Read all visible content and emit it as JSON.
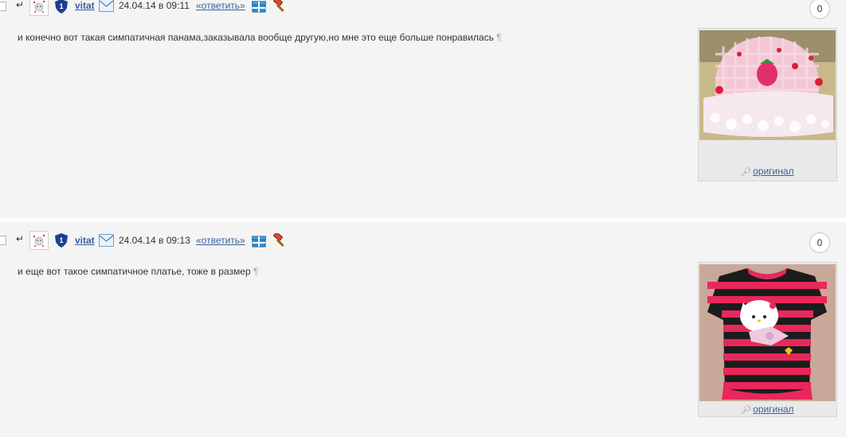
{
  "posts": [
    {
      "username": "vitat",
      "date": "24.04.14 в 09:11",
      "reply_label": "«ответить»",
      "counter": "0",
      "text": "и конечно вот такая симпатичная панама,заказывала вообще другую,но мне это еще больше понравилась",
      "pilcrow": "¶",
      "original_label": "оригинал"
    },
    {
      "username": "vitat",
      "date": "24.04.14 в 09:13",
      "reply_label": "«ответить»",
      "counter": "0",
      "text": "и еще вот такое симпатичное платье, тоже в размер",
      "pilcrow": "¶",
      "original_label": "оригинал"
    }
  ],
  "header_arrow": "↵",
  "rank_badge": "1",
  "icons": [
    "checkbox",
    "reply-arrow-icon",
    "avatar",
    "rank-shield-icon",
    "mail-icon",
    "gift-icon",
    "hammer-icon",
    "magnifier-icon"
  ],
  "colors": {
    "link": "#3a5f9a",
    "background": "#f4f4f4",
    "shield": "#1c3f94",
    "gift": "#2a8fd6",
    "hammer": "#d9482b"
  }
}
